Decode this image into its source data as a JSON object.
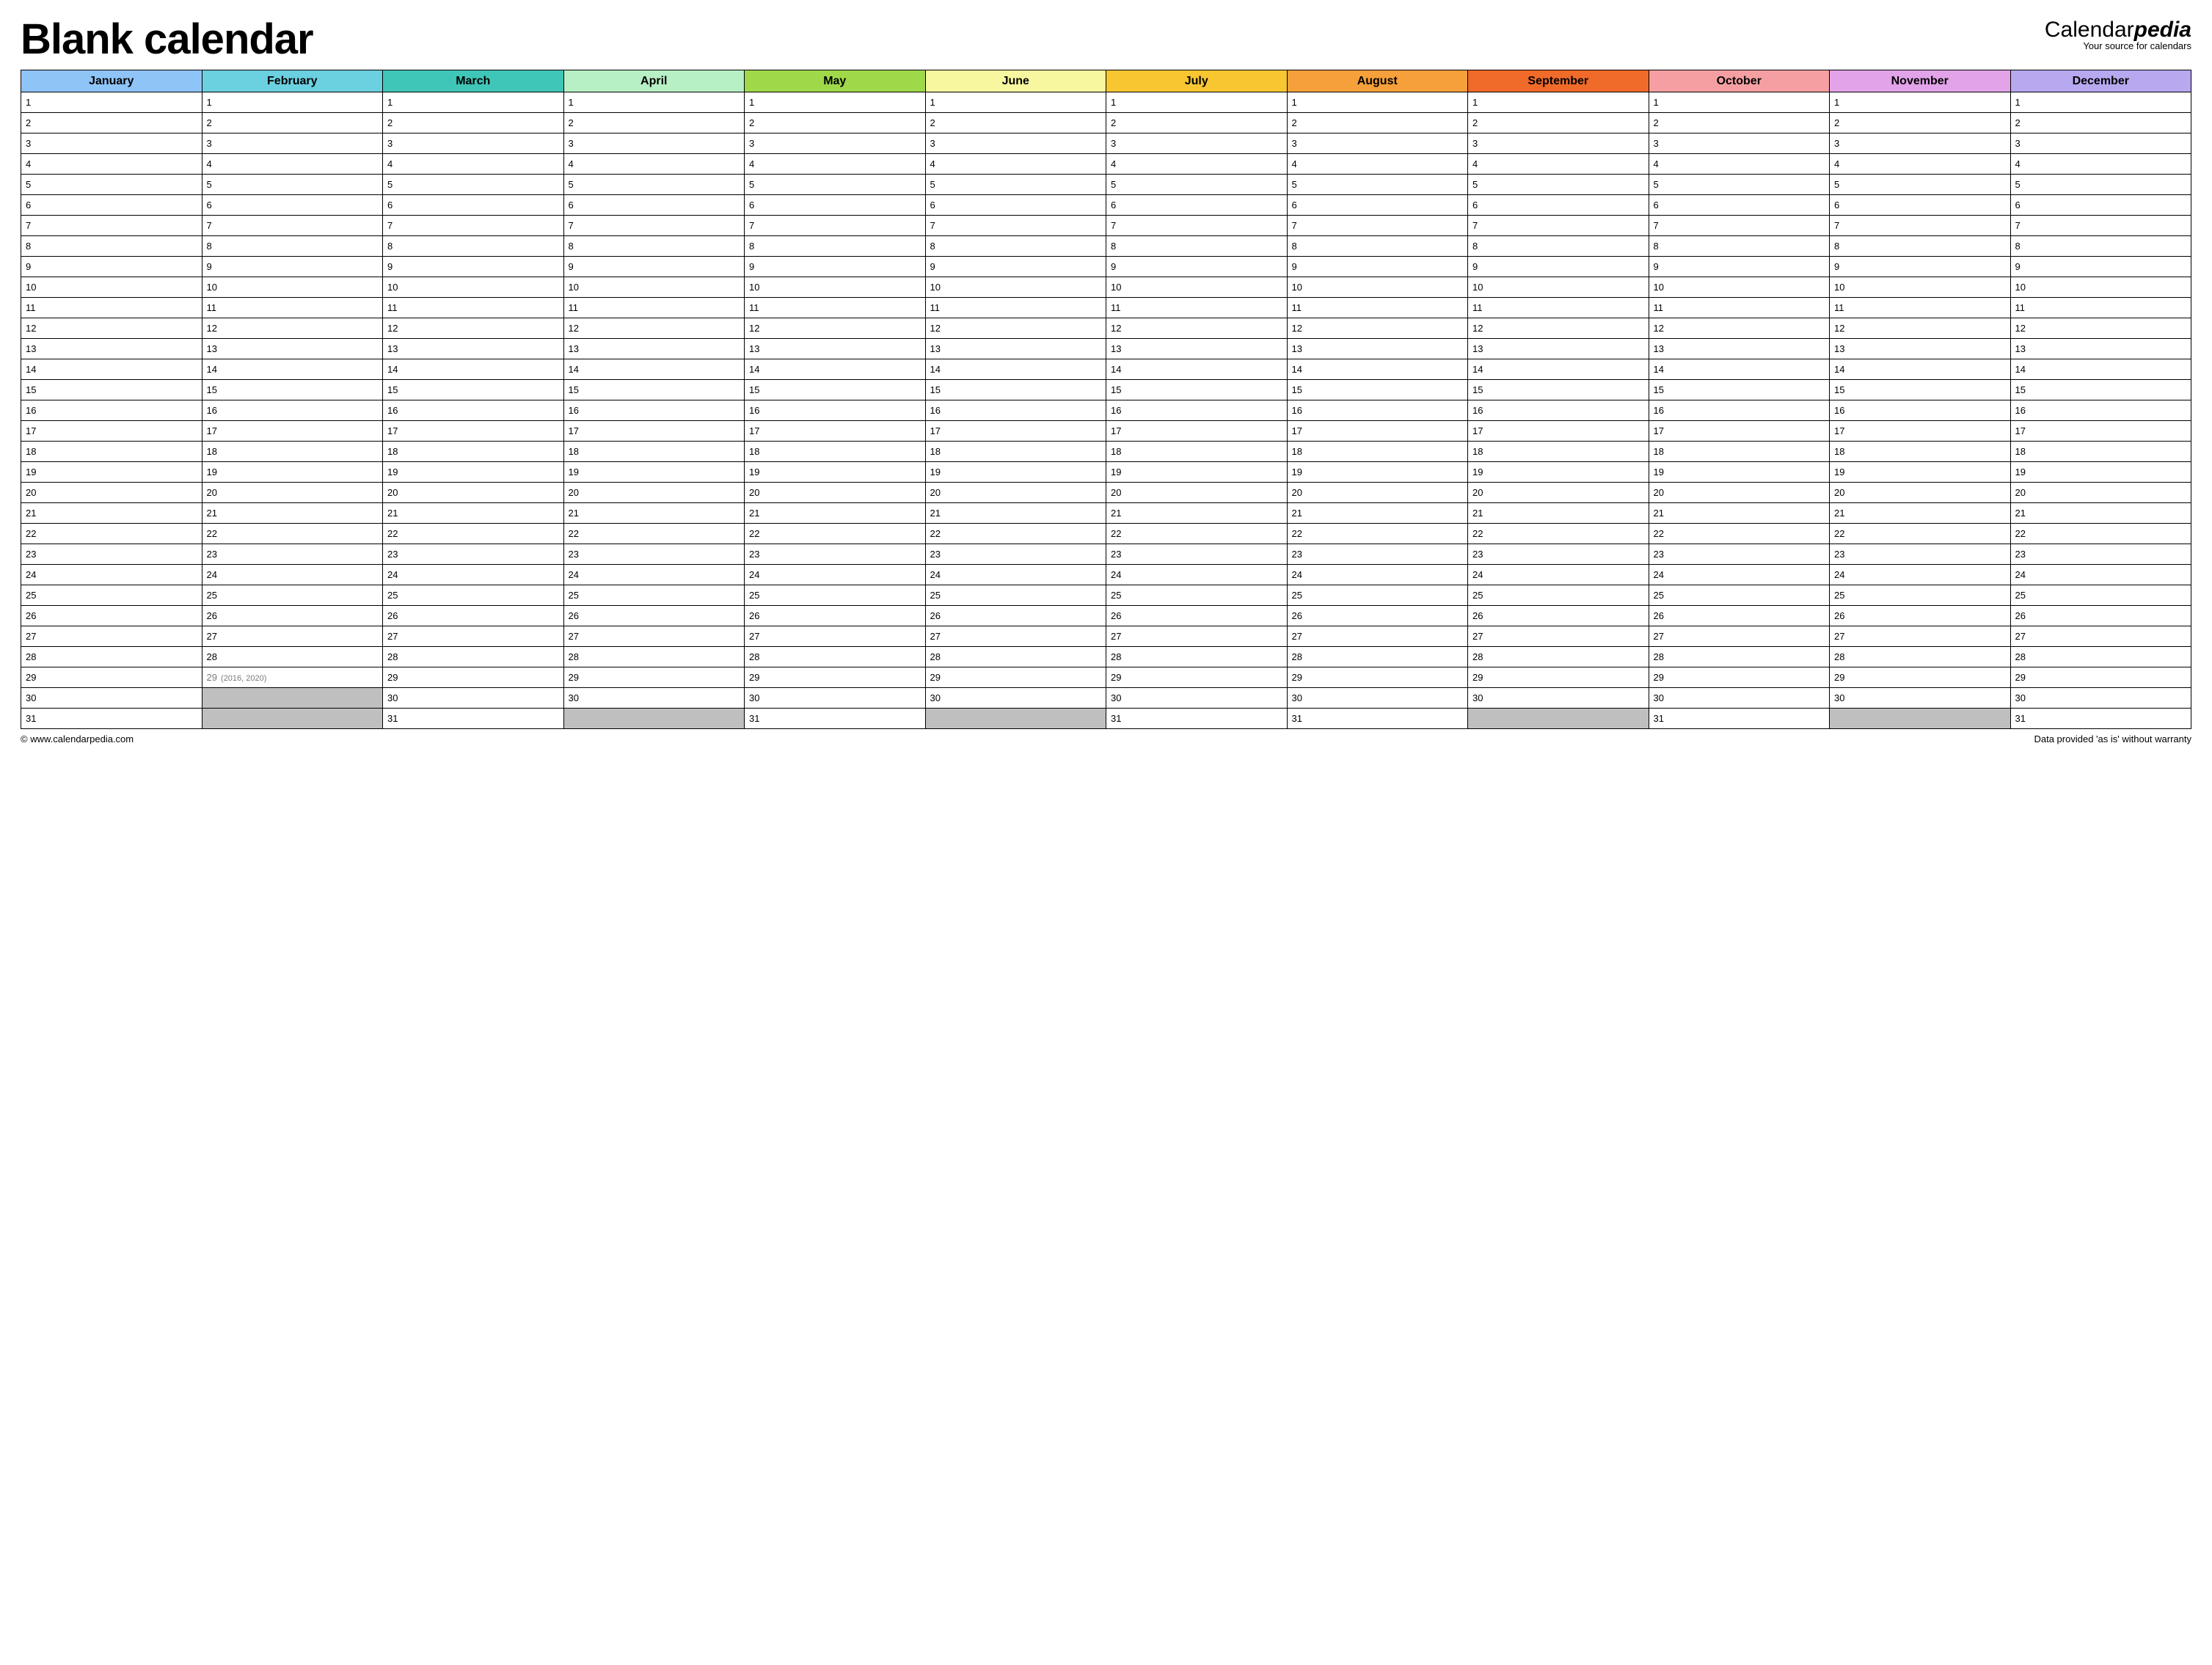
{
  "header": {
    "title": "Blank calendar",
    "brand_prefix": "Calendar",
    "brand_suffix": "pedia",
    "brand_tagline": "Your source for calendars"
  },
  "months": [
    {
      "name": "January",
      "color": "#8fc4f7",
      "days": 31
    },
    {
      "name": "February",
      "color": "#6bd0e0",
      "days": 29,
      "day29_note": "(2016, 2020)"
    },
    {
      "name": "March",
      "color": "#40c6b8",
      "days": 31
    },
    {
      "name": "April",
      "color": "#b8f0c6",
      "days": 30
    },
    {
      "name": "May",
      "color": "#9fd94a",
      "days": 31
    },
    {
      "name": "June",
      "color": "#f7f7a0",
      "days": 30
    },
    {
      "name": "July",
      "color": "#f7c631",
      "days": 31
    },
    {
      "name": "August",
      "color": "#f5a03a",
      "days": 31
    },
    {
      "name": "September",
      "color": "#f06a2a",
      "days": 30
    },
    {
      "name": "October",
      "color": "#f59fa2",
      "days": 31
    },
    {
      "name": "November",
      "color": "#e2a3e8",
      "days": 30
    },
    {
      "name": "December",
      "color": "#b7a8f0",
      "days": 31
    }
  ],
  "max_rows": 31,
  "footer": {
    "left": "© www.calendarpedia.com",
    "right": "Data provided 'as is' without warranty"
  }
}
